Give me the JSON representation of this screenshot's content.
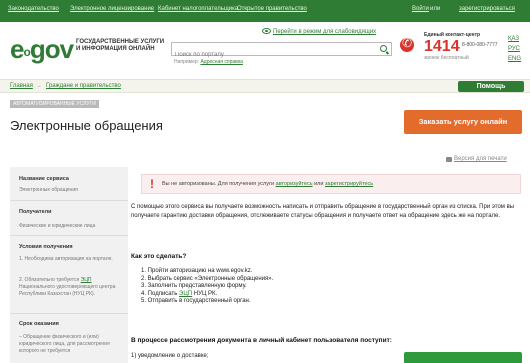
{
  "topbar": {
    "links": [
      "Законодательство",
      "Электронное лицензирование",
      "Кабинет налогоплательщика",
      "Открытое правительство"
    ],
    "login": "Войти",
    "or": "или",
    "register": "зарегистрироваться"
  },
  "header": {
    "logo_e": "e",
    "logo_sub": "o",
    "logo_gov": "gov",
    "logo_text": [
      "ГОСУДАРСТВЕННЫЕ УСЛУГИ",
      "И ИНФОРМАЦИЯ ОНЛАЙН"
    ],
    "blind_link": "Перейти в режим для слабовидящих",
    "search_placeholder": "Поиск по порталу",
    "example_label": "Например:",
    "example_link": "Адресная справка",
    "contact_label": "Единый контакт-центр",
    "phone_main": "1414",
    "phone_alt": "8-800-080-7777",
    "phone_note": "звонок бесплатный",
    "languages": [
      "ҚАЗ",
      "РУС",
      "ENG"
    ]
  },
  "breadcrumb": {
    "items": [
      "Главная",
      "Граждане и правительство"
    ],
    "separator": "→",
    "help_label": "Помощь"
  },
  "page": {
    "tag": "Автоматизированные услуги",
    "title": "Электронные обращения",
    "order_button": "Заказать услугу онлайн",
    "print_link": "Версия для печати"
  },
  "sidebar": {
    "service_name_head": "Название сервиса",
    "service_name": "Электронные обращения",
    "recipients_head": "Получатели",
    "recipients": "Физические и юридические лица",
    "conditions_head": "Условия получения",
    "condition_1": "1. Необходима авторизация на портале.",
    "condition_2_pre": "2. Обязательно требуется",
    "condition_2_link": "ЭЦП",
    "condition_2_post": "Национального удостоверяющего центра Республики Казахстан (НУЦ РК).",
    "term_head": "Срок оказания",
    "term": "– Обращение физического и (или) юридического лица, для рассмотрения которого не требуется"
  },
  "alert": {
    "text_pre": "Вы не авторизованы. Для получения услуги",
    "login_link": "авторизуйтесь",
    "or": "или",
    "register_link": "зарегистрируйтесь"
  },
  "main": {
    "intro": "С помощью этого сервиса вы получаете возможность написать и отправить обращение в государственный орган из списка. При этом вы получаете гарантию доставки обращения, отслеживаете статусы обращения и получаете ответ на обращение здесь же на портале.",
    "how_head": "Как это сделать?",
    "step_1": "1. Пройти авторизацию на www.egov.kz.",
    "step_2": "2. Выбрать сервис «Электронные обращения».",
    "step_3": "3. Заполнить представленную форму.",
    "step_4_pre": "4. Подписать",
    "step_4_link": "ЭЦП",
    "step_4_post": "НУЦ РК.",
    "step_5": "5. Отправить в государственный орган.",
    "process_head": "В процессе рассмотрения документа в личный кабинет пользователя поступит:",
    "notice_1": "1) уведомление о доставке;"
  },
  "colors": {
    "brand_green": "#2f7d34",
    "accent_orange": "#e36b2c",
    "alert_red": "#d9342b"
  }
}
